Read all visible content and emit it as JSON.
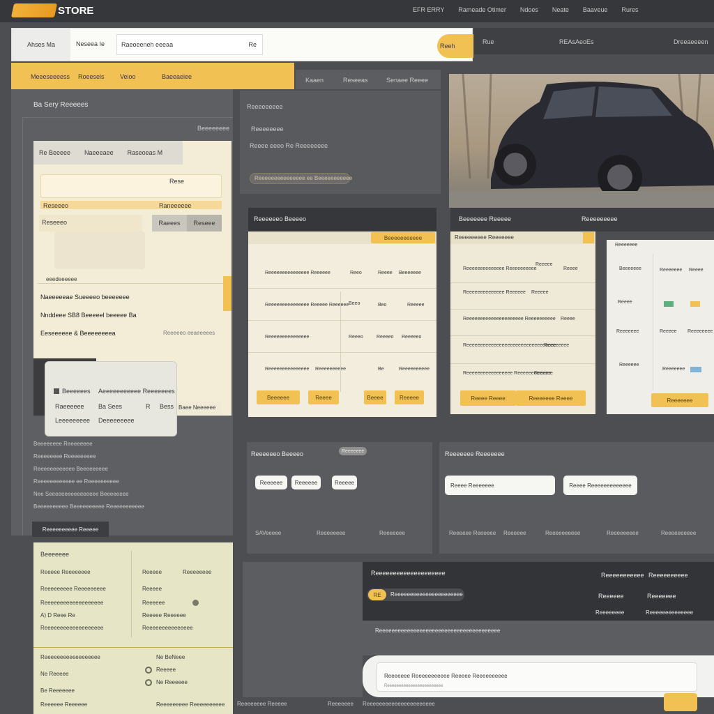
{
  "header": {
    "logo_text": "STORE",
    "nav": [
      "EFR ERRY",
      "Rameade Otimer",
      "Ndoes",
      "Neate",
      "Baaveue",
      "Rures"
    ]
  },
  "search": {
    "tab_label": "Ahses Ma",
    "field1_label": "Neseea Ie",
    "field2_placeholder": "Raeoeeneh eeeaa",
    "arrow": "Re",
    "button_label": "Reeh"
  },
  "topbar_right": [
    "Rue",
    "REAsAeoEs",
    "Dreeaeeeen"
  ],
  "category_tabs": [
    "Meeeseeeess",
    "Roeeseis",
    "Veioo",
    "Baeeaeiee"
  ],
  "sub_tabs": [
    "Kaaen",
    "Reseeas",
    "Senaee Reeee"
  ],
  "left_panel": {
    "title": "Ba Sery Reeeees",
    "subtitle": "Beeeeeeee",
    "card_tabs": [
      "Re Beeeee",
      "Naeeeaee",
      "Raseoeas M"
    ],
    "input_hint": "Rese",
    "labels": [
      "Reseeeo",
      "Raneeeeee"
    ],
    "buttons": [
      "Raeees",
      "Reseee"
    ],
    "note": "eeedeeeeee",
    "lines": [
      "Naeeeeeae Sueeeeo beeeeeee",
      "Nnddeee SB8 Beeeeel beeeee Ba",
      "Eeseeeeee & Beeeeeeeea"
    ],
    "side_link": "Reeeeeo eeaeeeees"
  },
  "popup": {
    "rows": [
      [
        "Beeeeees",
        "Aeeeeeeeeeee Reeeeeees"
      ],
      [
        "Raeeeeee",
        "Ba Sees",
        "R",
        "Bess"
      ],
      [
        "Leeeeeeeee",
        "Deeeeeeeee"
      ]
    ],
    "side_label": "Baee Neeeeee"
  },
  "left_list": [
    "Beeeeeeee Reeeeeeee",
    "Reeeeeeee Reeeeeeeee",
    "Reeeeeeeeeeee Beeeeeeeee",
    "Reeeeeeeeeeee ee Reeeeeeeeee",
    "Nee Seeeeeeeeeeeeeeee Beeeeeeee",
    "Beeeeeeeeee Beeeeeeeeee Reeeeeeeeeee"
  ],
  "dark_button": "Reeeeeeeeee Reeeee",
  "info": {
    "title": "Reeeeeeeee",
    "subtitle": "Reeeeeeee",
    "text": "Reeee eeeo Re Reeeeeeee",
    "bar_label": "Reeeeeeeeeeeeeee ee Beeeeeeeeeee"
  },
  "table1": {
    "title": "Reeeeeeo Beeeeo",
    "header_btn": "Beeeeeeeeeee",
    "rows": [
      [
        "Reeeeeeeeeeeeeee Reeeeee",
        "Reeo",
        "Reeee",
        "Beeeeeee"
      ],
      [
        "Reeeeeeeeeeeeeee Reeeee Reeeeee",
        "Beeo",
        "Beo",
        "Reeeee"
      ],
      [
        "Reeeeeeeeeeeeeee",
        "Reeeo",
        "Reeeeo",
        "Reeeeeo"
      ],
      [
        "Reeeeeeeeeeeeeee",
        "Reeeeeeeeee",
        "Be",
        "Reeeeeeeeee"
      ]
    ],
    "buttons": [
      "Beeeeee",
      "Reeee",
      "Beeee",
      "Reeeee"
    ]
  },
  "table2": {
    "title": "Beeeeeee Reeeee",
    "tag": "Reeeeeeeee",
    "header": "Reeeeeeeee Reeeeeee",
    "rows": [
      [
        "Reeeeeeeeeeeeee Reeeeeeeeee",
        "Reeeee",
        "Reeee"
      ],
      [
        "Reeeeeeeeeeeeee Reeeeee",
        "Reeeee"
      ],
      [
        "Reeeeeeeeeeeeeeeeeeeee Reeeeeeeeee",
        "Reeee"
      ],
      [
        "Reeeeeeeeeeeeeeeeeeeeeeeeeeeeeeeee",
        "Reeeeeeee"
      ],
      [
        "Reeeeeeeeeeeeeeeee Reeeeeeeeeeeee",
        "Reeeee"
      ]
    ],
    "buttons": [
      "Reeee Reeee",
      "Reeeeeee Reeee"
    ]
  },
  "table3": {
    "header": "Reeeeeee",
    "cells": [
      "Beeeeeee",
      "Reeeeeee",
      "Reeee",
      "Reeee",
      "Reeeeeee",
      "Reeeee",
      "Reeeeeeee",
      "Reeeeee",
      "Reeeeeee"
    ],
    "button": "Reeeeeee"
  },
  "filter1": {
    "title": "Reeeeeeo Beeeeo",
    "tag": "Reeeeeee",
    "chips": [
      "Reeeeee",
      "Reeeeee",
      "Reeeee"
    ],
    "footer": [
      "SAVeeeee",
      "Reeeeeeee",
      "Reeeeeee"
    ]
  },
  "filter2": {
    "title": "Reeeeeee Reeeeeee",
    "inputs": [
      "Reeee Reeeeeee",
      "Reeee Reeeeeeeeeeeee"
    ],
    "footer": [
      "Reeeeee Reeeeee",
      "Reeeeee",
      "Reeeeeeeeee",
      "Reeeeeeeee",
      "Reeeeeeeeee"
    ]
  },
  "bottom_left": {
    "title": "Beeeeeee",
    "rows": [
      [
        "Reeeee Reeeeeeee",
        "Reeeee",
        "Reeeeeeee"
      ],
      [
        "Reeeeeeeee Reeeeeeeee",
        "Reeeee"
      ],
      [
        "Reeeeeeeeeeeeeeeeeee",
        "Reeeeee"
      ],
      [
        "A) D Reee Re",
        "Reeeee Reeeeee"
      ],
      [
        "Reeeeeeeeeeeeeeeeeee",
        "Reeeeeeeeeeeeeee"
      ],
      [
        "Reeeeeeeeeeeeeeeeee",
        "Ne BeNeee"
      ],
      [
        "Ne Reeeee",
        "Reeeee"
      ],
      [
        "Be Reeeeeee",
        "Ne Reeeeee"
      ],
      [
        "Reeeeee Reeeeee",
        "Reeeeeeeee Reeeeeeeeee"
      ]
    ]
  },
  "dark_panel": {
    "title": "Reeeeeeeeeeeeeeeeeeee",
    "cols": [
      "Reeeeeeeeeee",
      "Reeeeeeeeee"
    ],
    "badge": "RE",
    "badge_text": "Reeeeeeeeeeeeeeeeeeeeee",
    "right_rows": [
      [
        "Reeeeee",
        "Reeeeeee"
      ],
      [
        "Reeeeeeee",
        "Reeeeeeeeeeeeee"
      ]
    ],
    "line": "Reeeeeeeeeeeeeeeeeeeeeeeeeeeeeeeeeeeeeee"
  },
  "bottom_bar": {
    "text": "Reeeeeee Reeeeeeeeeee Reeeee Reeeeeeeeee",
    "sub": "Reeeeeeeeeeeeeeeeeeeeeeee"
  },
  "footer": [
    "Reeeeeeee Reeeee",
    "Reeeeeee",
    "Reeeeeeeeeeeeeeeeeeeeee"
  ],
  "colors": {
    "accent": "#f2c153",
    "dark": "#3b3c40",
    "panel": "#f2eddc"
  }
}
